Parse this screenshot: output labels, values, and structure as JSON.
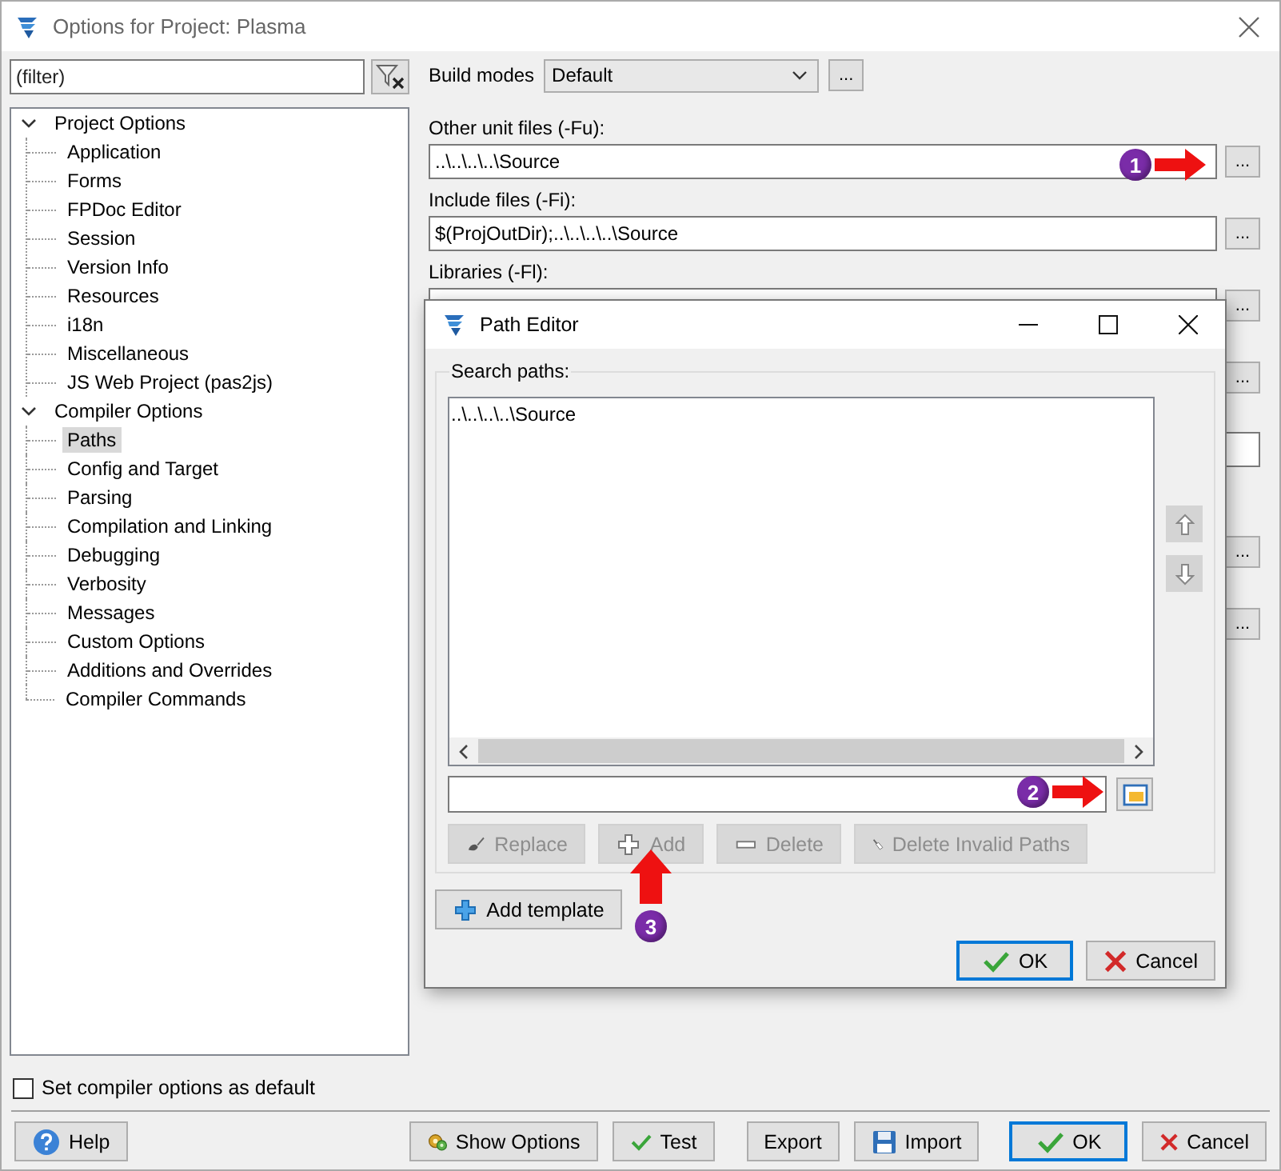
{
  "window": {
    "title": "Options for Project: Plasma"
  },
  "filter": {
    "placeholder": "(filter)"
  },
  "tree": [
    {
      "label": "Project Options",
      "expanded": true,
      "selected": false,
      "children": [
        {
          "label": "Application",
          "selected": false
        },
        {
          "label": "Forms",
          "selected": false
        },
        {
          "label": "FPDoc Editor",
          "selected": false
        },
        {
          "label": "Session",
          "selected": false
        },
        {
          "label": "Version Info",
          "selected": false
        },
        {
          "label": "Resources",
          "selected": false
        },
        {
          "label": "i18n",
          "selected": false
        },
        {
          "label": "Miscellaneous",
          "selected": false
        },
        {
          "label": "JS Web Project (pas2js)",
          "selected": false
        }
      ]
    },
    {
      "label": "Compiler Options",
      "expanded": true,
      "selected": false,
      "children": [
        {
          "label": "Paths",
          "selected": true
        },
        {
          "label": "Config and Target",
          "selected": false
        },
        {
          "label": "Parsing",
          "selected": false
        },
        {
          "label": "Compilation and Linking",
          "selected": false
        },
        {
          "label": "Debugging",
          "selected": false
        },
        {
          "label": "Verbosity",
          "selected": false
        },
        {
          "label": "Messages",
          "selected": false
        },
        {
          "label": "Custom Options",
          "selected": false
        },
        {
          "label": "Additions and Overrides",
          "selected": false
        },
        {
          "label": "Compiler Commands",
          "selected": false
        }
      ]
    }
  ],
  "build_modes": {
    "label": "Build modes",
    "value": "Default",
    "button": "..."
  },
  "path_rows": [
    {
      "kind": "path",
      "label": "Other unit files (-Fu):",
      "value": "..\\..\\..\\..\\Source",
      "button": "..."
    },
    {
      "kind": "path",
      "label": "Include files (-Fi):",
      "value": "$(ProjOutDir);..\\..\\..\\..\\Source",
      "button": "..."
    },
    {
      "kind": "path",
      "label": "Libraries (-Fl):",
      "button": "..."
    },
    {
      "kind": "button_only",
      "button": "..."
    },
    {
      "kind": "field_only"
    },
    {
      "kind": "button_only",
      "button": "..."
    },
    {
      "kind": "button_only",
      "button": "..."
    }
  ],
  "default_checkbox": {
    "label": "Set compiler options as default",
    "checked": false
  },
  "buttons": [
    {
      "label": "Help",
      "kind": "help",
      "default": false
    },
    {
      "label": "Show Options",
      "kind": "show",
      "default": false
    },
    {
      "label": "Test",
      "kind": "check",
      "default": false
    },
    {
      "label": "Export",
      "kind": "plain",
      "default": false
    },
    {
      "label": "Import",
      "kind": "import",
      "default": false
    },
    {
      "label": "OK",
      "kind": "check",
      "default": true
    },
    {
      "label": "Cancel",
      "kind": "cancel",
      "default": false
    }
  ],
  "path_editor": {
    "title": "Path Editor",
    "group_label": "Search paths:",
    "paths": [
      {
        "text": "..\\..\\..\\..\\Source",
        "selected": false
      }
    ],
    "move_buttons": [
      {
        "kind": "up",
        "disabled": true
      },
      {
        "kind": "down",
        "disabled": true
      }
    ],
    "actions": [
      {
        "label": "Replace",
        "kind": "replace",
        "disabled": true
      },
      {
        "label": "Add",
        "kind": "add",
        "disabled": true
      },
      {
        "label": "Delete",
        "kind": "delete",
        "disabled": true
      },
      {
        "label": "Delete Invalid Paths",
        "kind": "broom",
        "disabled": true
      }
    ],
    "add_template": {
      "label": "Add template",
      "kind": "add",
      "disabled": false
    },
    "buttons": [
      {
        "label": "OK",
        "kind": "check",
        "default": true
      },
      {
        "label": "Cancel",
        "kind": "cancel",
        "default": false
      }
    ]
  },
  "annotations": [
    {
      "number": "1",
      "kind": "right"
    },
    {
      "number": "2",
      "kind": "right"
    },
    {
      "number": "3",
      "kind": "up"
    }
  ]
}
